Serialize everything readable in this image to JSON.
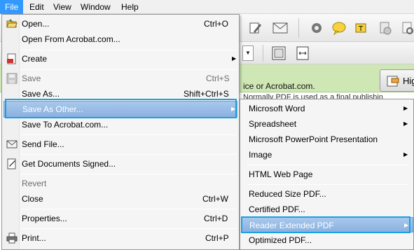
{
  "menubar": {
    "items": [
      "File",
      "Edit",
      "View",
      "Window",
      "Help"
    ]
  },
  "background": {
    "green_text": "ice or Acrobat.com.",
    "doc_text": "Normally PDF is used as a final publishin",
    "highlight_label": "Hig"
  },
  "file_menu": {
    "open": {
      "label": "Open...",
      "shortcut": "Ctrl+O"
    },
    "open_from_acrobat": {
      "label": "Open From Acrobat.com..."
    },
    "create": {
      "label": "Create"
    },
    "save": {
      "label": "Save",
      "shortcut": "Ctrl+S"
    },
    "save_as": {
      "label": "Save As...",
      "shortcut": "Shift+Ctrl+S"
    },
    "save_as_other": {
      "label": "Save As Other..."
    },
    "save_to_acrobat": {
      "label": "Save To Acrobat.com..."
    },
    "send_file": {
      "label": "Send File..."
    },
    "get_signed": {
      "label": "Get Documents Signed..."
    },
    "revert": {
      "label": "Revert"
    },
    "close": {
      "label": "Close",
      "shortcut": "Ctrl+W"
    },
    "properties": {
      "label": "Properties...",
      "shortcut": "Ctrl+D"
    },
    "print": {
      "label": "Print...",
      "shortcut": "Ctrl+P"
    }
  },
  "submenu": {
    "word": "Microsoft Word",
    "spreadsheet": "Spreadsheet",
    "powerpoint": "Microsoft PowerPoint Presentation",
    "image": "Image",
    "html": "HTML Web Page",
    "reduced": "Reduced Size PDF...",
    "certified": "Certified PDF...",
    "reader_extended": "Reader Extended PDF",
    "optimized": "Optimized PDF..."
  },
  "colors": {
    "menu_highlight": "#3399ff",
    "hover_item": "#8bb1df",
    "callout": "#1ba1e2",
    "green_bar": "#cfe7b4"
  }
}
